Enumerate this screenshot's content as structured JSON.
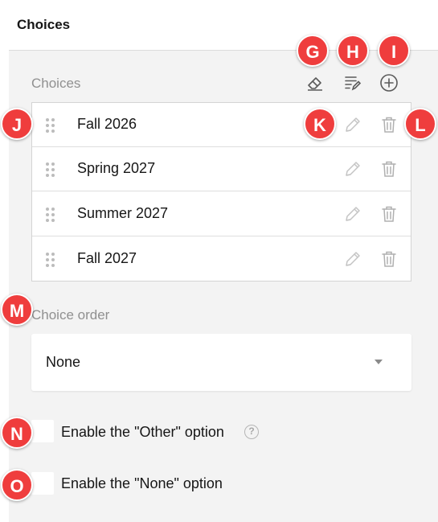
{
  "header": {
    "title": "Choices"
  },
  "choices_section": {
    "label": "Choices",
    "toolbar": [
      {
        "icon": "eraser-icon",
        "action": "clear-choices"
      },
      {
        "icon": "edit-list-icon",
        "action": "bulk-edit"
      },
      {
        "icon": "plus-circle-icon",
        "action": "add-choice"
      }
    ],
    "items": [
      {
        "label": "Fall 2026"
      },
      {
        "label": "Spring 2027"
      },
      {
        "label": "Summer 2027"
      },
      {
        "label": "Fall 2027"
      }
    ]
  },
  "choice_order": {
    "label": "Choice order",
    "value": "None"
  },
  "options": {
    "other_label": "Enable the \"Other\" option",
    "help_glyph": "?",
    "none_label": "Enable the \"None\" option"
  },
  "annotations": [
    "G",
    "H",
    "I",
    "J",
    "K",
    "L",
    "M",
    "N",
    "O"
  ],
  "colors": {
    "panel_bg": "#f3f3f3",
    "badge_red": "#ef3d3d",
    "icon_gray": "#7a7a7a",
    "muted_label": "#909090"
  }
}
